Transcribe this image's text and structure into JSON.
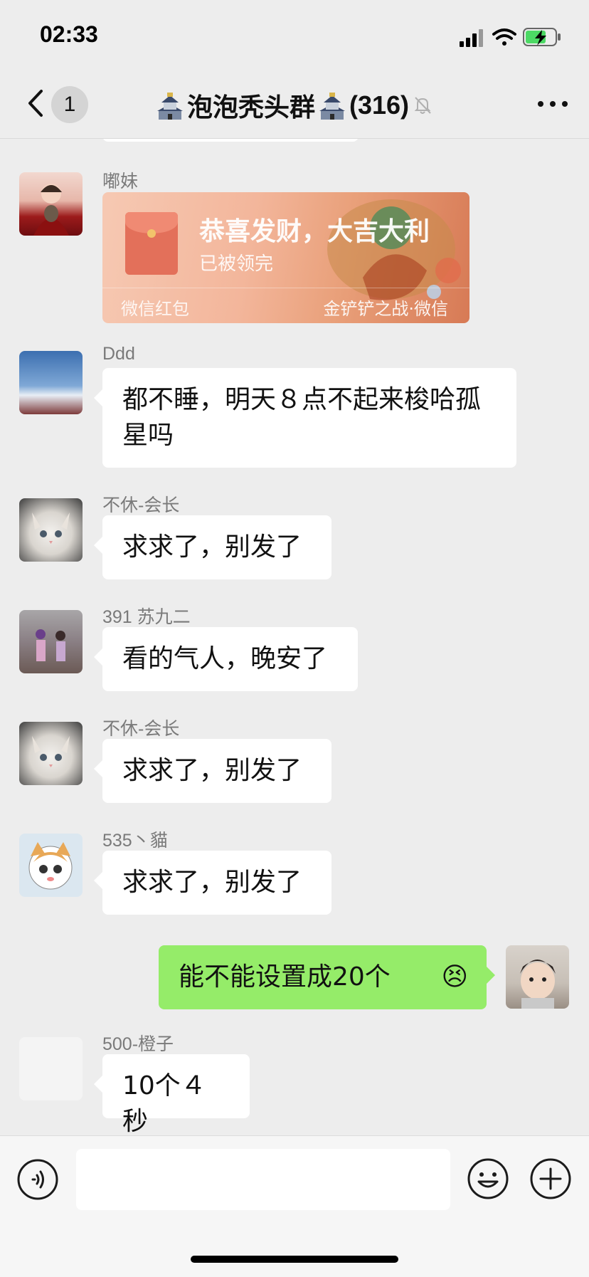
{
  "status": {
    "time": "02:33"
  },
  "nav": {
    "unread_badge": "1",
    "title": "泡泡秃头群",
    "member_count": "(316)"
  },
  "messages": [
    {
      "sender": "嘟妹",
      "type": "red_packet",
      "red_packet": {
        "greeting": "恭喜发财，大吉大利",
        "status": "已被领完",
        "label": "微信红包",
        "source": "金铲铲之战·微信"
      }
    },
    {
      "sender": "Ddd",
      "text": "都不睡，明天８点不起来梭哈孤星吗"
    },
    {
      "sender": "不休-会长",
      "text": "求求了，别发了"
    },
    {
      "sender": "391 苏九二",
      "text": "看的气人，晚安了"
    },
    {
      "sender": "不休-会长",
      "text": "求求了，别发了"
    },
    {
      "sender": "535丶貓",
      "text": "求求了，别发了"
    },
    {
      "sender": "me",
      "text": "能不能设置成20个",
      "emoji": "😣"
    },
    {
      "sender": "500-橙子",
      "text": "10个４秒"
    }
  ],
  "colors": {
    "background": "#ededed",
    "my_bubble": "#95ec69",
    "other_bubble": "#ffffff"
  },
  "icons": [
    "back-chevron-icon",
    "castle-icon",
    "mute-bell-icon",
    "more-icon",
    "voice-icon",
    "emoji-icon",
    "plus-icon"
  ]
}
